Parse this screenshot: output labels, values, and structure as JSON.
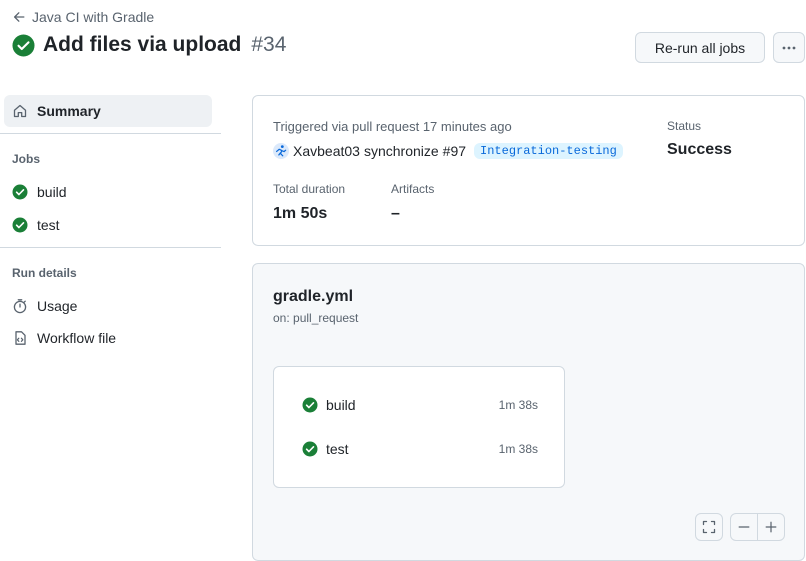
{
  "header": {
    "back_label": "Java CI with Gradle",
    "title": "Add files via upload",
    "run_number": "#34",
    "rerun_label": "Re-run all jobs",
    "more_icon": "kebab-horizontal-icon"
  },
  "sidebar": {
    "summary_label": "Summary",
    "jobs_heading": "Jobs",
    "jobs": [
      {
        "label": "build",
        "status": "success"
      },
      {
        "label": "test",
        "status": "success"
      }
    ],
    "run_details_heading": "Run details",
    "usage_label": "Usage",
    "workflow_file_label": "Workflow file"
  },
  "summary": {
    "triggered_text": "Triggered via pull request 17 minutes ago",
    "actor": "Xavbeat03",
    "action": "synchronize",
    "pr_number": "#97",
    "branch": "Integration-testing",
    "status_label": "Status",
    "status_value": "Success",
    "duration_label": "Total duration",
    "duration_value": "1m 50s",
    "artifacts_label": "Artifacts",
    "artifacts_value": "–"
  },
  "graph": {
    "workflow_name": "gradle.yml",
    "trigger": "on: pull_request",
    "jobs": [
      {
        "label": "build",
        "duration": "1m 38s"
      },
      {
        "label": "test",
        "duration": "1m 38s"
      }
    ]
  },
  "colors": {
    "success": "#1a7f37",
    "accent": "#0969da",
    "border": "#d1d9e0",
    "muted": "#59636e"
  }
}
